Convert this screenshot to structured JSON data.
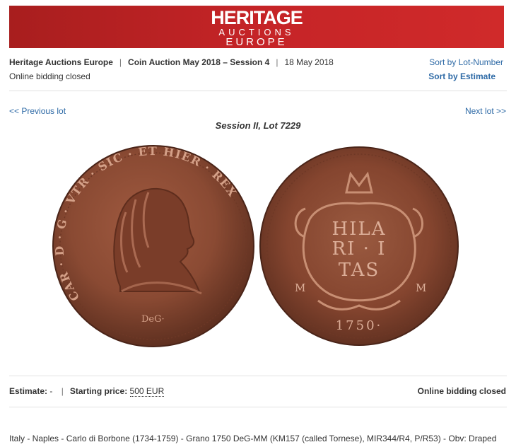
{
  "header": {
    "brand_main": "HERITAGE",
    "brand_sub": "AUCTIONS",
    "brand_region": "EUROPE",
    "brand_color": "#c52427"
  },
  "breadcrumb": {
    "house": "Heritage Auctions Europe",
    "auction": "Coin Auction May 2018 – Session 4",
    "date": "18 May 2018",
    "separator": "|"
  },
  "status": "Online bidding closed",
  "sort": {
    "lot_number": "Sort by Lot-Number",
    "estimate": "Sort by Estimate"
  },
  "nav": {
    "prev": "<< Previous lot",
    "next": "Next lot >>"
  },
  "lot_title": "Session II, Lot 7229",
  "coin": {
    "obverse_legend": "CAR · D · G · VTR · SIC · ET HIER · REX",
    "obverse_mark": "DeG·",
    "reverse_lines": [
      "HILA",
      "RI · I",
      "TAS"
    ],
    "reverse_left": "M",
    "reverse_right": "M",
    "reverse_date": "1750·"
  },
  "pricing": {
    "estimate_label": "Estimate:",
    "estimate_value": "-",
    "starting_label": "Starting price:",
    "starting_value": "500 EUR",
    "separator": "|",
    "status": "Online bidding closed"
  },
  "description": "Italy - Naples - Carlo di Borbone (1734-1759) - Grano 1750 DeG-MM (KM157 (called Tornese), MIR344/R4, P/R53) - Obv: Draped"
}
